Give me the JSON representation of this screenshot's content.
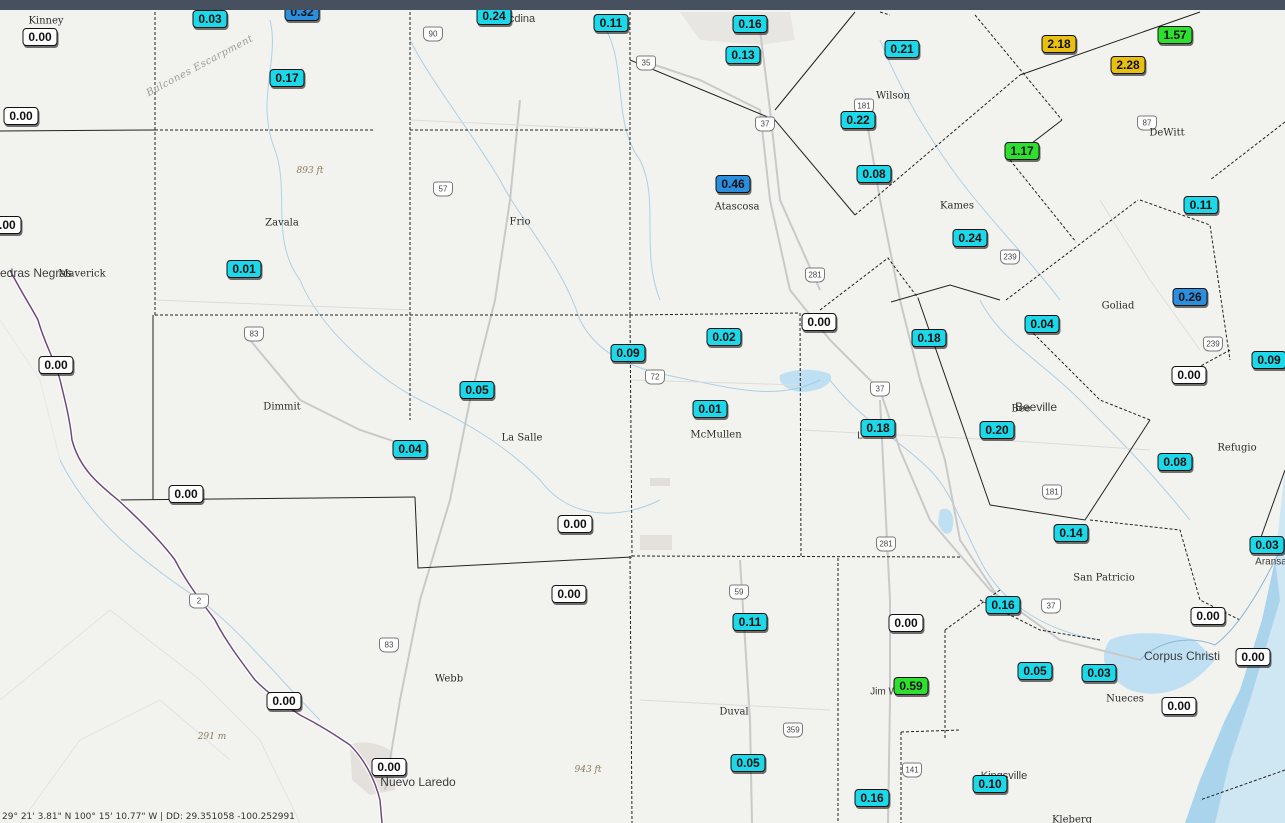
{
  "colors": {
    "zero": "#ffffff",
    "low": "#1cd8e8",
    "mid": "#2b8fe0",
    "high": "#2ee02e",
    "very_high": "#e9bf12"
  },
  "county_names": [
    "Kinney",
    "Maverick",
    "Zavala",
    "Frio",
    "Atascosa",
    "Wilson",
    "Kames",
    "DeWitt",
    "Goliad",
    "Dimmit",
    "La Salle",
    "McMullen",
    "Bee",
    "Refugio",
    "Webb",
    "Duval",
    "Nueces",
    "San Patricio",
    "Kleberg"
  ],
  "city_names": [
    "edras Negras",
    "Corpus Christi",
    "Nuevo Laredo",
    "Beeville",
    "Aransa",
    "Jim W",
    "L",
    "Kingsville",
    "cdina"
  ],
  "relief_labels": [
    "893 ft",
    "291 m",
    "943 ft"
  ],
  "escarpment_label": "Balcones Escarpment",
  "highway_shields": [
    "90",
    "35",
    "37",
    "181",
    "87",
    "57",
    "281",
    "239",
    "83",
    "72",
    "37",
    "181",
    "239",
    "2",
    "83",
    "59",
    "359",
    "281",
    "141",
    "37"
  ],
  "readings": [
    "0.03",
    "0.32",
    "0.24",
    "0.11",
    "0.16",
    "0.17",
    "0.13",
    "0.21",
    "2.18",
    "1.57",
    "2.28",
    "0.00",
    "0.00",
    "0.22",
    "1.17",
    "0.08",
    "0.46",
    "0.11",
    "0.24",
    "0.01",
    "0.00",
    "0.26",
    "0.04",
    "0.18",
    "0.00",
    "0.02",
    "0.09",
    "0.09",
    "0.00",
    "0.05",
    "0.01",
    "0.00",
    "0.20",
    "0.04",
    "0.18",
    "0.08",
    "0.00",
    "0.14",
    "0.00",
    "0.03",
    "0.16",
    "0.00",
    "0.00",
    "0.11",
    "0.00",
    "0.05",
    "0.03",
    "0.00",
    "0.59",
    "0.00",
    "0.05",
    "0.10",
    "0.16",
    "0.00"
  ],
  "status_bar": "29° 21' 3.81\" N 100° 15' 10.77\" W | DD: 29.351058 -100.252991"
}
